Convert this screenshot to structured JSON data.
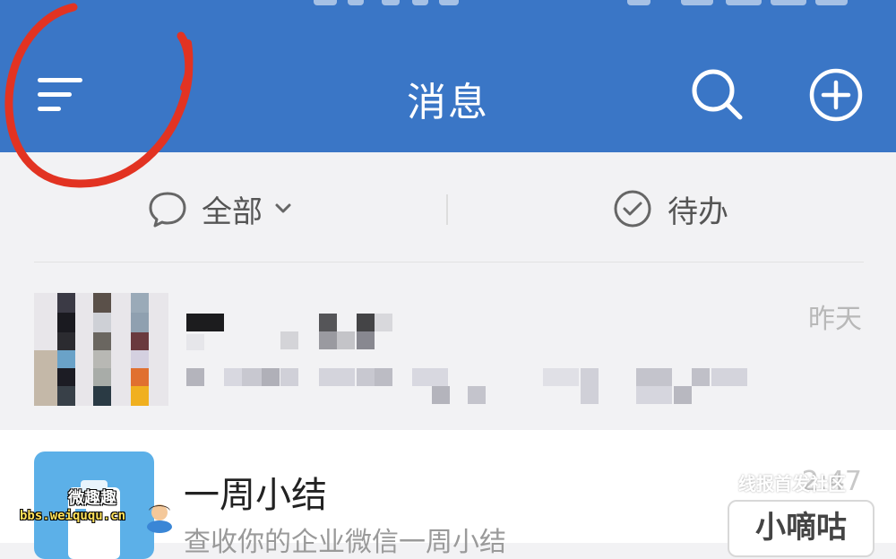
{
  "header": {
    "title": "消息",
    "menu_icon": "menu-icon",
    "search_icon": "search-icon",
    "add_icon": "plus-circle-icon",
    "background_color": "#3a76c6"
  },
  "filters": {
    "all_label": "全部",
    "todo_label": "待办",
    "all_icon": "chat-bubble-icon",
    "todo_icon": "check-circle-icon"
  },
  "messages": [
    {
      "time": "昨天",
      "blurred": true
    },
    {
      "title": "一周小结",
      "preview": "查收你的企业微信一周小结",
      "time": "2:47"
    }
  ],
  "watermarks": {
    "left_title": "微趣趣",
    "left_url": "bbs.weiququ.cn",
    "right_top": "线报首发社区",
    "right_box": "小嘀咕"
  },
  "colors": {
    "annotation": "#e23322"
  }
}
